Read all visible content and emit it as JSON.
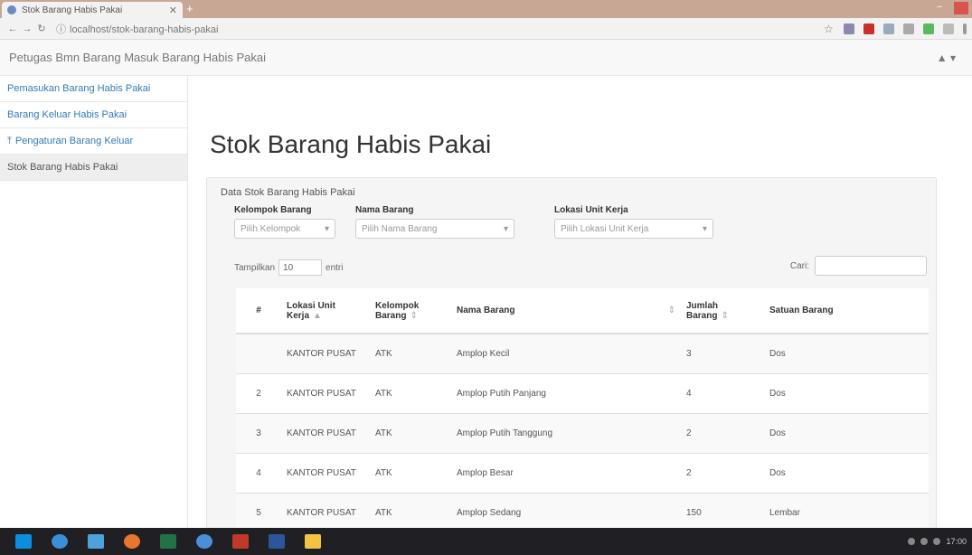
{
  "browser": {
    "tab_title": "Stok Barang Habis Pakai",
    "tab_close": "✕",
    "new_tab": "+",
    "url": "localhost/stok-barang-habis-pakai",
    "minimize": "‒",
    "colors": {
      "tabstrip": "#c8a894",
      "close": "#d9534f"
    }
  },
  "navbar": {
    "brand": "Petugas Bmn Barang Masuk Barang Habis Pakai",
    "user_menu": "▲ ▾"
  },
  "sidebar": {
    "items": [
      {
        "label": "Pemasukan Barang Habis Pakai",
        "icon": "none"
      },
      {
        "label": "Barang Keluar Habis Pakai",
        "icon": "none"
      },
      {
        "label": "Pengaturan Barang Keluar",
        "icon": "upload-icon"
      },
      {
        "label": "Stok Barang Habis Pakai",
        "icon": "none",
        "active": true
      }
    ]
  },
  "main": {
    "title": "Stok Barang Habis Pakai",
    "panel_heading": "Data Stok Barang Habis Pakai",
    "filters": [
      {
        "label": "Kelompok Barang",
        "value": "Pilih Kelompok"
      },
      {
        "label": "Nama Barang",
        "value": "Pilih Nama Barang"
      },
      {
        "label": "Lokasi Unit Kerja",
        "value": "Pilih Lokasi Unit Kerja"
      }
    ],
    "show_entries": {
      "prefix": "Tampilkan",
      "value": "10",
      "suffix": "entri"
    },
    "search_label": "Cari:",
    "table": {
      "headers": [
        "#",
        "Lokasi Unit Kerja",
        "Kelompok Barang",
        "Nama Barang",
        "Jumlah Barang",
        "Satuan Barang"
      ],
      "rows": [
        [
          "",
          "KANTOR PUSAT",
          "ATK",
          "Amplop Kecil",
          "3",
          "Dos"
        ],
        [
          "2",
          "KANTOR PUSAT",
          "ATK",
          "Amplop Putih Panjang",
          "4",
          "Dos"
        ],
        [
          "3",
          "KANTOR PUSAT",
          "ATK",
          "Amplop Putih Tanggung",
          "2",
          "Dos"
        ],
        [
          "4",
          "KANTOR PUSAT",
          "ATK",
          "Amplop Besar",
          "2",
          "Dos"
        ],
        [
          "5",
          "KANTOR PUSAT",
          "ATK",
          "Amplop Sedang",
          "150",
          "Lembar"
        ]
      ]
    }
  },
  "taskbar": {
    "clock": "17:00"
  }
}
